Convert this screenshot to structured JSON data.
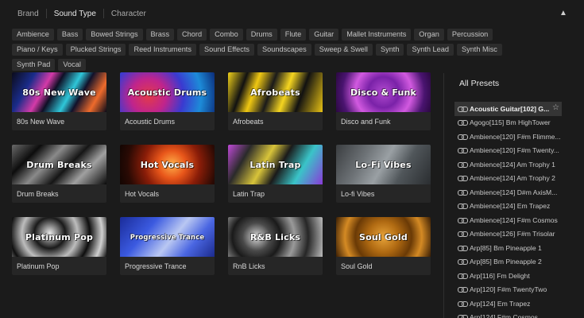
{
  "filter_tabs": [
    "Brand",
    "Sound Type",
    "Character"
  ],
  "active_tab": "Sound Type",
  "collapse_icon": "chevron-up-icon",
  "tags": [
    "Ambience",
    "Bass",
    "Bowed Strings",
    "Brass",
    "Chord",
    "Combo",
    "Drums",
    "Flute",
    "Guitar",
    "Mallet Instruments",
    "Organ",
    "Percussion",
    "Piano / Keys",
    "Plucked Strings",
    "Reed Instruments",
    "Sound Effects",
    "Soundscapes",
    "Sweep & Swell",
    "Synth",
    "Synth Lead",
    "Synth Misc",
    "Synth Pad",
    "Vocal"
  ],
  "cards": [
    {
      "art_title": "80s New Wave",
      "name": "80s New Wave",
      "bg": "linear-gradient(120deg,#0b0b1a 0%,#1a2c8a 20%,#d43aa8 35%,#0f0f25 45%,#2fc7d9 60%,#11112a 70%,#ee6b2c 85%,#0a0a18 100%)"
    },
    {
      "art_title": "Acoustic Drums",
      "name": "Acoustic Drums",
      "bg": "radial-gradient(circle at 30% 60%,#e23a4a 0%,#c0248c 25%,#3a3ad0 50%,#1d8bd8 75%,#0b2c7a 100%)"
    },
    {
      "art_title": "Afrobeats",
      "name": "Afrobeats",
      "bg": "linear-gradient(110deg,#f2d21a 0%,#111 18%,#f0c812 30%,#1a1a1a 45%,#f5d520 60%,#111 75%,#e8c214 100%)"
    },
    {
      "art_title": "Disco & Funk",
      "name": "Disco and Funk",
      "bg": "radial-gradient(circle at 50% 50%,#b24ad0 0%,#7a22a8 30%,#d25ae0 55%,#4a1470 80%,#2a0840 100%)"
    },
    {
      "art_title": "Drum Breaks",
      "name": "Drum Breaks",
      "bg": "linear-gradient(135deg,#6a6a6a 0%,#0d0d0d 22%,#8a8a8a 40%,#151515 58%,#a0a0a0 75%,#0a0a0a 100%)"
    },
    {
      "art_title": "Hot Vocals",
      "name": "Hot Vocals",
      "bg": "radial-gradient(circle at 55% 50%,#ffb04a 0%,#e8561a 25%,#8a1d08 50%,#2a0a04 80%,#120502 100%)"
    },
    {
      "art_title": "Latin Trap",
      "name": "Latin Trap",
      "bg": "linear-gradient(120deg,#c04ad8 0%,#2a2a2a 20%,#d8c43a 40%,#1a1a1a 55%,#3ac4c8 75%,#8a3ad8 100%)"
    },
    {
      "art_title": "Lo-Fi Vibes",
      "name": "Lo-fi Vibes",
      "bg": "linear-gradient(120deg,#3a3d40 0%,#6e7377 30%,#9aa0a4 50%,#50565a 70%,#2a2d30 100%)"
    },
    {
      "art_title": "Platinum Pop",
      "name": "Platinum Pop",
      "bg": "radial-gradient(circle at 40% 40%,#e8e8e8 0%,#1a1a1a 25%,#bdbdbd 45%,#0e0e0e 65%,#d0d0d0 85%,#111 100%)"
    },
    {
      "art_title": "Progressive Trance",
      "name": "Progressive Trance",
      "bg": "linear-gradient(130deg,#1a2c9a 0%,#3b5ae0 30%,#b9c7f2 55%,#4a66e2 75%,#1b2a8c 100%)"
    },
    {
      "art_title": "R&B Licks",
      "name": "RnB Licks",
      "bg": "radial-gradient(circle at 30% 50%,#d9d9d9 0%,#4a4a4a 20%,#1a1a1a 35%,#9a9a9a 55%,#262626 75%,#bdbdbd 100%)"
    },
    {
      "art_title": "Soul Gold",
      "name": "Soul Gold",
      "bg": "radial-gradient(circle at 50% 50%,#e8a43a 0%,#b06a12 30%,#6a3a06 55%,#d48a24 75%,#3a1e04 100%)"
    }
  ],
  "presets_title": "All Presets",
  "presets": [
    "Acoustic Guitar[102] G...",
    "Agogo[115] Bm HighTower",
    "Ambience[120] F#m Flimme...",
    "Ambience[120] F#m Twenty...",
    "Ambience[124] Am Trophy 1",
    "Ambience[124] Am Trophy 2",
    "Ambience[124] D#m AxisM...",
    "Ambience[124] Em Trapez",
    "Ambience[124] F#m Cosmos",
    "Ambience[126] F#m Trisolar",
    "Arp[85] Bm Pineapple 1",
    "Arp[85] Bm Pineapple 2",
    "Arp[116] Fm Delight",
    "Arp[120] F#m TwentyTwo",
    "Arp[124] Em Trapez",
    "Arp[124] F#m Cosmos"
  ],
  "selected_preset": "Acoustic Guitar[102] G...",
  "preset_icon": "link-icon",
  "favorite_icon": "star-icon"
}
